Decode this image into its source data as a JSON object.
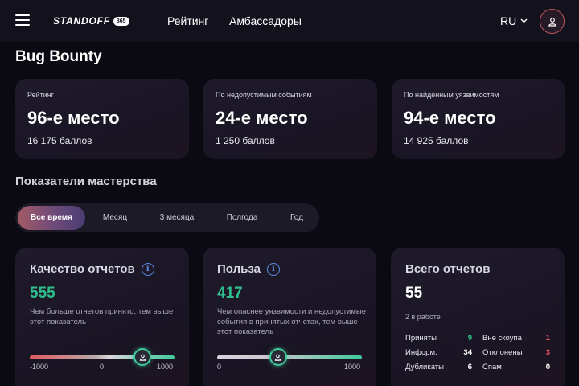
{
  "header": {
    "logo_text": "STANDOFF",
    "logo_badge": "365",
    "nav": [
      "Рейтинг",
      "Амбассадоры"
    ],
    "lang": "RU"
  },
  "page_title": "Bug Bounty",
  "ranks": [
    {
      "label": "Рейтинг",
      "place": "96-е место",
      "points": "16 175 баллов"
    },
    {
      "label": "По недопустимым событиям",
      "place": "24-е место",
      "points": "1 250 баллов"
    },
    {
      "label": "По найденным уязвимостям",
      "place": "94-е место",
      "points": "14 925 баллов"
    }
  ],
  "mastery": {
    "title": "Показатели мастерства",
    "tabs": [
      "Все время",
      "Месяц",
      "3 месяца",
      "Полгода",
      "Год"
    ],
    "active_tab": "Все время"
  },
  "quality": {
    "title": "Качество отчетов",
    "value": "555",
    "description": "Чем больше отчетов принято, тем выше этот показатель",
    "min_label": "-1000",
    "mid_label": "0",
    "max_label": "1000",
    "slider_fraction": 0.78
  },
  "benefit": {
    "title": "Польза",
    "value": "417",
    "description": "Чем опаснее уязвимости и недопустимые события в принятых отчетах, тем выше этот показатель",
    "min_label": "0",
    "max_label": "1000",
    "slider_fraction": 0.42
  },
  "total": {
    "title": "Всего отчетов",
    "value": "55",
    "in_work": "2 в работе",
    "left_stats": [
      {
        "label": "Приняты",
        "value": "9",
        "color": "#2fbf8c"
      },
      {
        "label": "Информ.",
        "value": "34",
        "color": "#ffffff"
      },
      {
        "label": "Дубликаты",
        "value": "6",
        "color": "#ffffff"
      }
    ],
    "right_stats": [
      {
        "label": "Вне скоупа",
        "value": "1",
        "color": "#e0525e"
      },
      {
        "label": "Отклонены",
        "value": "3",
        "color": "#e0525e"
      },
      {
        "label": "Спам",
        "value": "0",
        "color": "#ffffff"
      }
    ]
  },
  "colors": {
    "accent_green": "#2fbf8c",
    "accent_red": "#e0525e",
    "info_blue": "#5b8ee8"
  }
}
